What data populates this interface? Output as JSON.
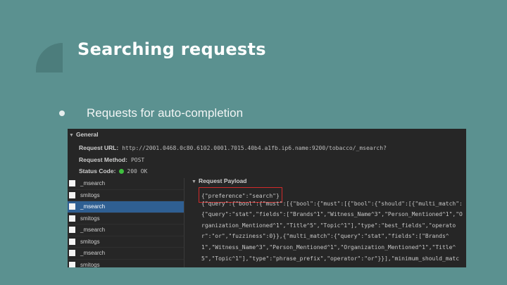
{
  "slide": {
    "title": "Searching requests",
    "bullets": [
      "Requests for auto-completion"
    ]
  },
  "devtools": {
    "general": {
      "header": "General",
      "url_label": "Request URL:",
      "url_value": "http://2001.0468.0c80.6102.0001.7015.40b4.a1fb.ip6.name:9200/tobacco/_msearch?",
      "method_label": "Request Method:",
      "method_value": "POST",
      "status_label": "Status Code:",
      "status_value": "200 OK"
    },
    "requests": [
      {
        "name": "_msearch",
        "selected": false
      },
      {
        "name": "smitogs",
        "selected": false
      },
      {
        "name": "_msearch",
        "selected": true
      },
      {
        "name": "smitogs",
        "selected": false
      },
      {
        "name": "_msearch",
        "selected": false
      },
      {
        "name": "smitogs",
        "selected": false
      },
      {
        "name": "_msearch",
        "selected": false
      },
      {
        "name": "smitogs",
        "selected": false
      }
    ],
    "payload": {
      "header": "Request Payload",
      "preference": "{\"preference\":\"search\"}",
      "lines": [
        "{\"query\":{\"bool\":{\"must\":[{\"bool\":{\"must\":[{\"bool\":{\"should\":[{\"multi_match\":",
        "{\"query\":\"stat\",\"fields\":[\"Brands^1\",\"Witness_Name^3\",\"Person_Mentioned^1\",\"O",
        "rganization_Mentioned^1\",\"Title^5\",\"Topic^1\"],\"type\":\"best_fields\",\"operato",
        "r\":\"or\",\"fuzziness\":0}},{\"multi_match\":{\"query\":\"stat\",\"fields\":[\"Brands^",
        "1\",\"Witness_Name^3\",\"Person_Mentioned^1\",\"Organization_Mentioned^1\",\"Title^",
        "5\",\"Topic^1\"],\"type\":\"phrase_prefix\",\"operator\":\"or\"}}],\"minimum_should_matc"
      ]
    },
    "colors": {
      "selected_row": "#2f5f92",
      "highlight_border": "#d12a2a",
      "status_dot": "#3fbf3f"
    }
  }
}
